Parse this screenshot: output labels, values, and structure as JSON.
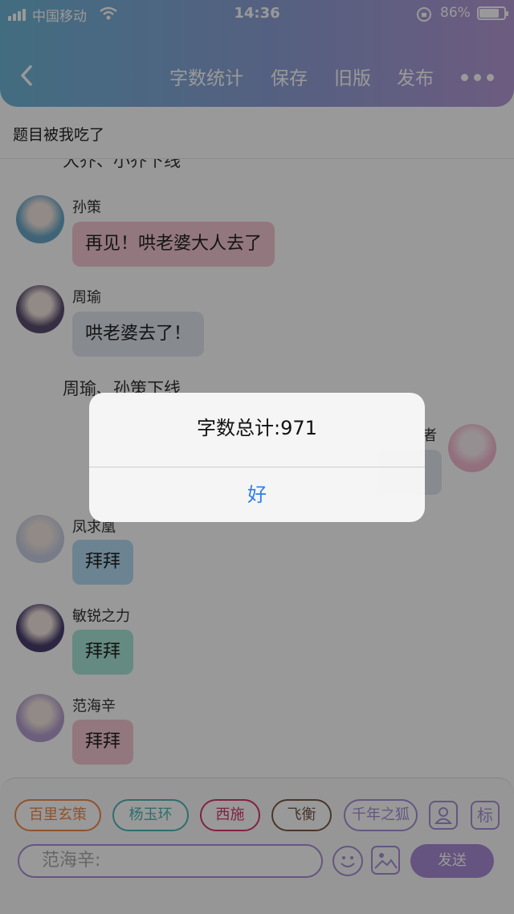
{
  "status_bar": {
    "carrier": "中国移动",
    "time": "14:36",
    "battery": "86%",
    "battery_level": 0.86
  },
  "nav": {
    "word_count": "字数统计",
    "save": "保存",
    "old_version": "旧版",
    "publish": "发布"
  },
  "document": {
    "title": "题目被我吃了"
  },
  "chat": {
    "partial_narration": "大乔、小乔下线",
    "messages": [
      {
        "name": "孙策",
        "text": "再见！哄老婆大人去了",
        "bubble_color": "#f6c7d2",
        "avatar_color": "#6aa7c8"
      },
      {
        "name": "周瑜",
        "text": "哄老婆去了！",
        "bubble_color": "#e1e6ee",
        "avatar_color": "#5a4d6e"
      },
      {
        "name": "凤求凰",
        "text": "拜拜",
        "bubble_color": "#b4dcf2",
        "avatar_color": "#c9cfe3"
      },
      {
        "name": "敏锐之力",
        "text": "拜拜",
        "bubble_color": "#a8e6d8",
        "avatar_color": "#4a3f6e"
      },
      {
        "name": "范海辛",
        "text": "拜拜",
        "bubble_color": "#f6c7d2",
        "avatar_color": "#b59fd0"
      }
    ],
    "narration": "周瑜、孙策下线",
    "right_name_fragment": "者",
    "right_avatar_color": "#f3b9cf"
  },
  "bottom_bar": {
    "characters": [
      {
        "label": "百里玄策",
        "color": "#f08a4b"
      },
      {
        "label": "杨玉环",
        "color": "#4fb6b6"
      },
      {
        "label": "西施",
        "color": "#d9386e"
      },
      {
        "label": "飞衡",
        "color": "#7a5a4a"
      },
      {
        "label": "千年之狐",
        "color": "#a88fd8"
      }
    ],
    "narration_button": "标",
    "input_placeholder": "范海辛:",
    "send": "发送"
  },
  "alert": {
    "title": "字数总计:971",
    "ok": "好"
  },
  "colors": {
    "accent": "#a88fd8",
    "link": "#2f7ee8"
  }
}
